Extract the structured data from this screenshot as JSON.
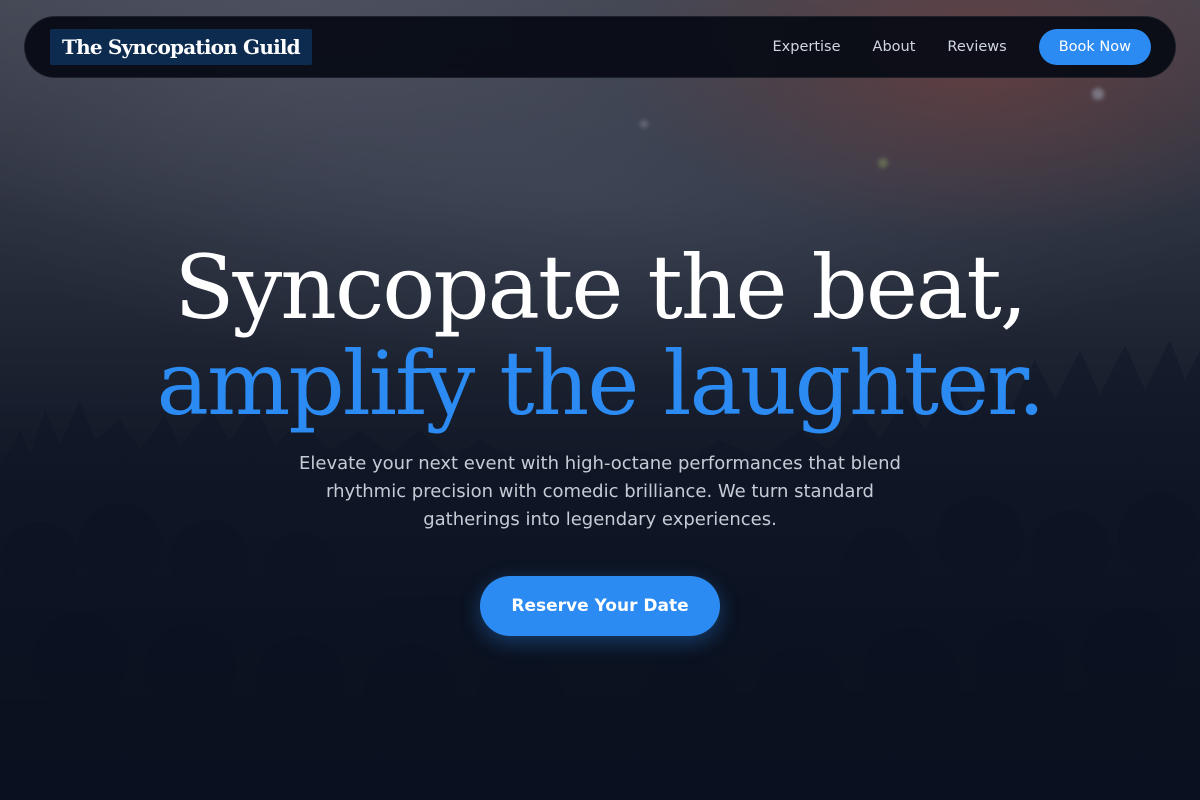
{
  "brand": {
    "name": "The Syncopation Guild"
  },
  "nav": {
    "links": [
      "Expertise",
      "About",
      "Reviews"
    ],
    "cta": "Book Now"
  },
  "hero": {
    "headline_line1": "Syncopate the beat,",
    "headline_line2": "amplify the laughter.",
    "subtitle": "Elevate your next event with high-octane performances that blend rhythmic precision with comedic brilliance. We turn standard gatherings into legendary experiences.",
    "cta": "Reserve Your Date",
    "background_image": "concert-crowd-photo"
  },
  "colors": {
    "accent": "#2b8bf2",
    "nav_bg": "#060a14",
    "logo_bg": "#0d2a4f",
    "page_bg": "#0b1322"
  }
}
